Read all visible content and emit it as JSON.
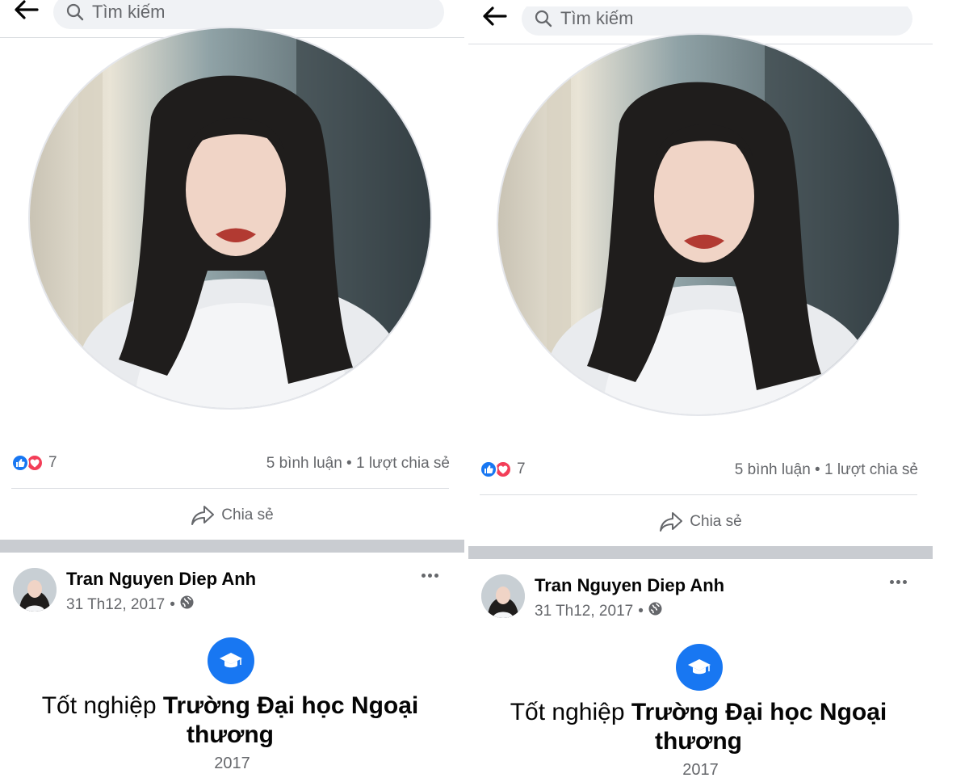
{
  "search": {
    "placeholder": "Tìm kiếm"
  },
  "reactions": {
    "count": "7"
  },
  "stats": "5 bình luận • 1 lượt chia sẻ",
  "share": {
    "label": "Chia sẻ"
  },
  "post": {
    "author": "Tran Nguyen Diep Anh",
    "date": "31 Th12, 2017",
    "dot": "•",
    "event_prefix": "Tốt nghiệp ",
    "event_school": "Trường Đại học Ngoại thương",
    "event_year": "2017"
  },
  "colors": {
    "accent": "#1877f2",
    "love": "#f33e58",
    "secondary_text": "#65676b"
  },
  "icons": [
    "back-arrow-icon",
    "search-icon",
    "like-icon",
    "love-icon",
    "share-icon",
    "globe-icon",
    "more-icon",
    "graduation-cap-icon"
  ]
}
